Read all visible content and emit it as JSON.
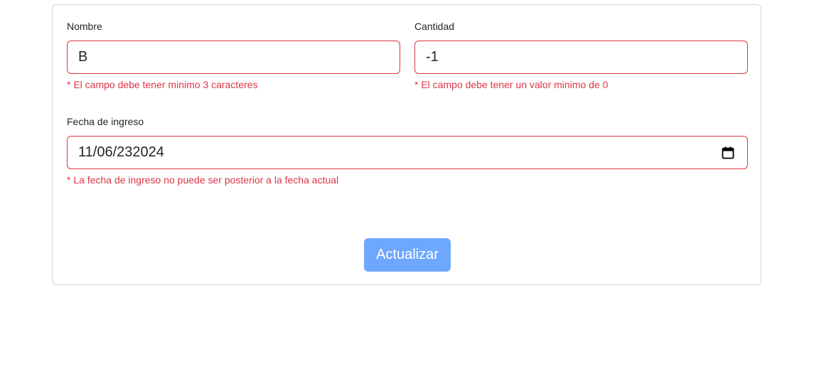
{
  "form": {
    "nombre": {
      "label": "Nombre",
      "value": "B",
      "error": "* El campo debe tener minimo 3 caracteres"
    },
    "cantidad": {
      "label": "Cantidad",
      "value": "-1",
      "error": "* El campo debe tener un valor minimo de 0"
    },
    "fecha": {
      "label": "Fecha de ingreso",
      "value": "11/06/232024",
      "error": "* La fecha de ingreso no puede ser posterior a la fecha actual",
      "icon": "calendar-icon"
    },
    "submit_label": "Actualizar"
  },
  "colors": {
    "error": "#dc3545",
    "button_bg": "#6ea8fe",
    "border": "#d0d3d6"
  }
}
